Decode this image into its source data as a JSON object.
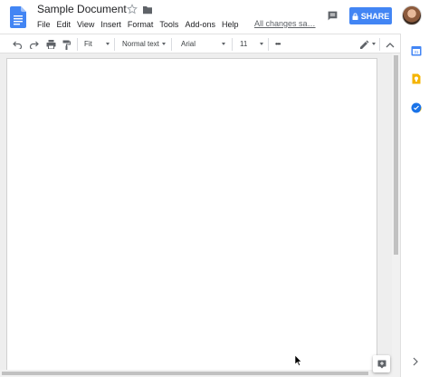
{
  "header": {
    "title": "Sample Document",
    "menus": [
      "File",
      "Edit",
      "View",
      "Insert",
      "Format",
      "Tools",
      "Add-ons",
      "Help"
    ],
    "save_status": "All changes sa…",
    "share_label": "SHARE"
  },
  "toolbar": {
    "zoom": "Fit",
    "style": "Normal text",
    "font": "Arial",
    "size": "11",
    "more": "•••"
  },
  "colors": {
    "accent": "#4285f4",
    "doc_blue": "#4285f4",
    "keep_yellow": "#f4b400",
    "tasks_blue": "#1a73e8"
  },
  "side_panel": {
    "icons": [
      "calendar-icon",
      "keep-icon",
      "tasks-icon"
    ]
  }
}
